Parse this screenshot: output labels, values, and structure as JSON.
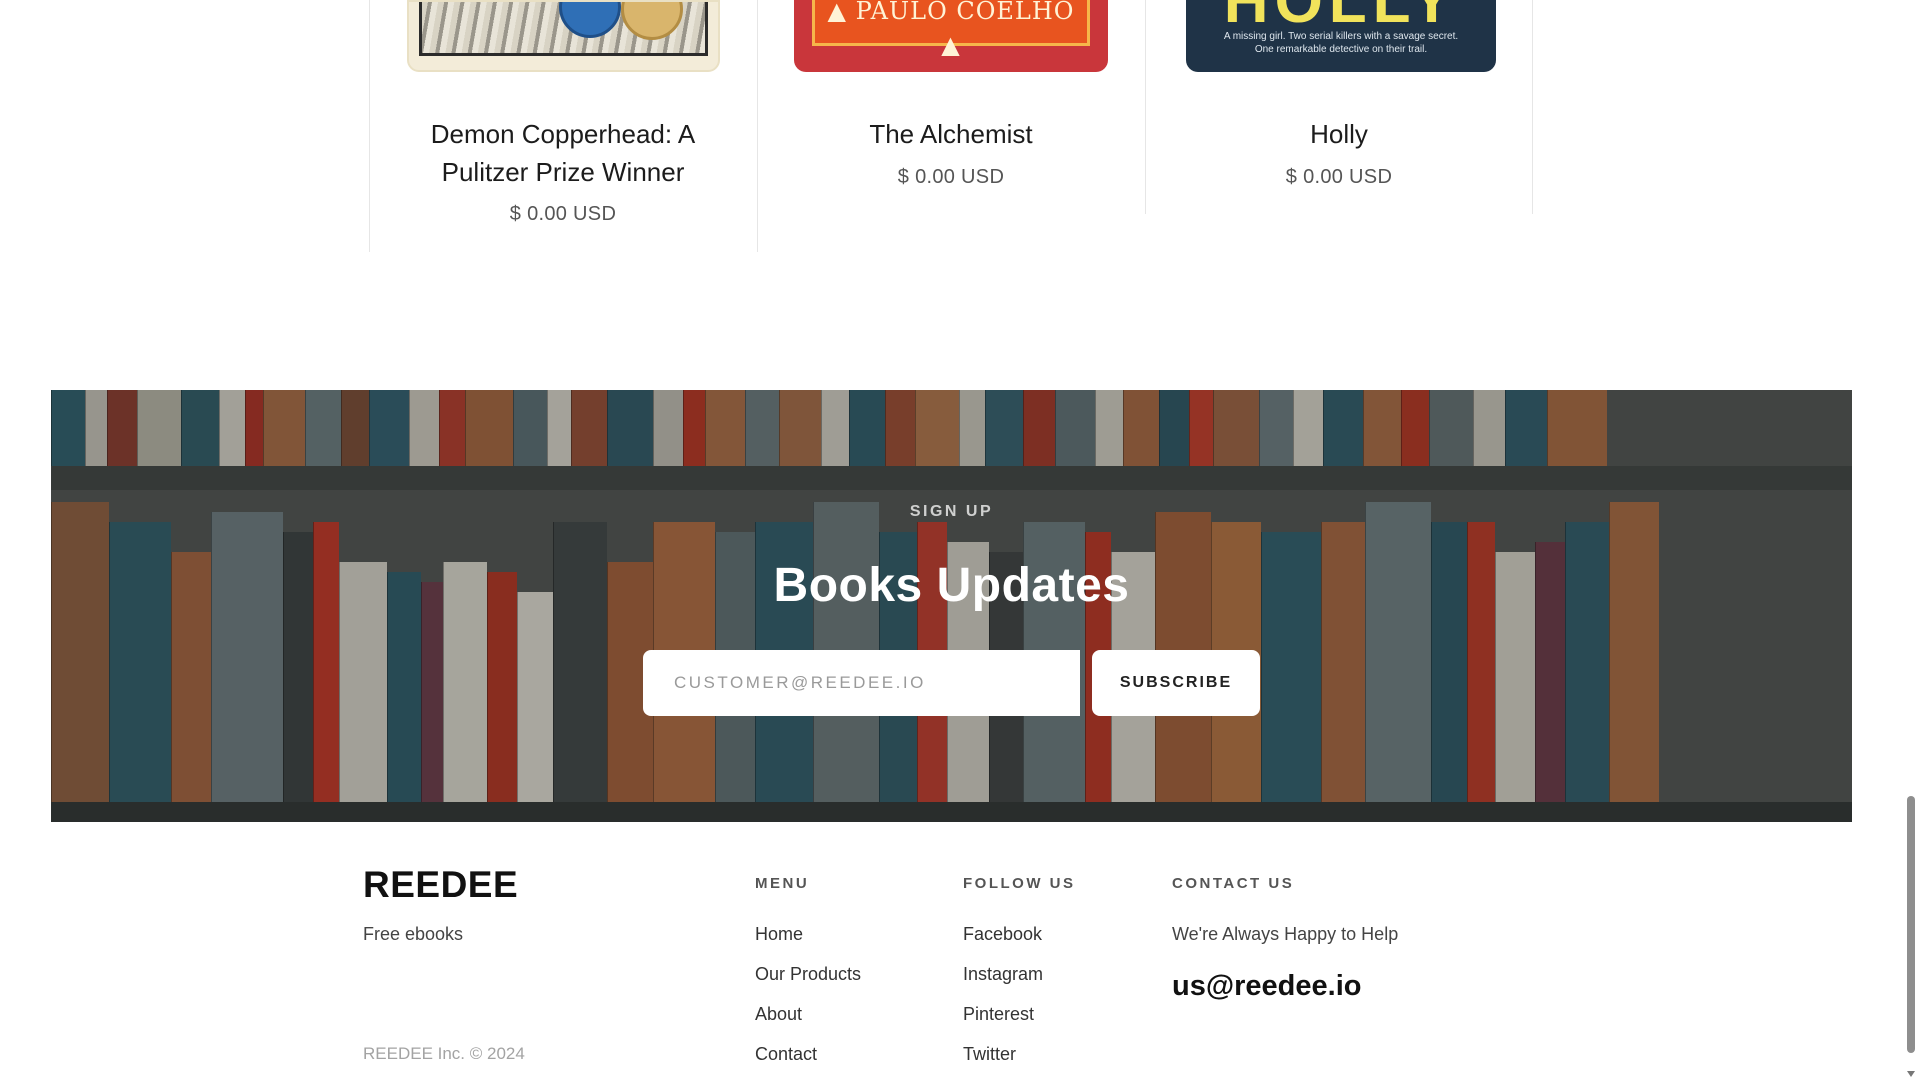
{
  "products": [
    {
      "title": "Demon Copperhead: A Pulitzer Prize Winner",
      "title_line1": "Demon Copperhead: A",
      "title_line2": "Pulitzer Prize Winner",
      "price": "$ 0.00 USD"
    },
    {
      "title": "The Alchemist",
      "cover_text": "PAULO COELHO",
      "price": "$ 0.00 USD"
    },
    {
      "title": "Holly",
      "cover_title": "HOLLY",
      "cover_tagline_1": "A missing girl. Two serial killers with a savage secret.",
      "cover_tagline_2": "One remarkable detective on their trail.",
      "price": "$ 0.00 USD"
    }
  ],
  "newsletter": {
    "eyebrow": "SIGN UP",
    "title": "Books Updates",
    "email_placeholder": "CUSTOMER@REEDEE.IO",
    "subscribe_label": "SUBSCRIBE"
  },
  "footer": {
    "brand": "REEDEE",
    "tagline": "Free ebooks",
    "copyright": "REEDEE Inc. © 2024",
    "menu": {
      "heading": "MENU",
      "links": [
        "Home",
        "Our Products",
        "About",
        "Contact"
      ]
    },
    "follow": {
      "heading": "FOLLOW US",
      "links": [
        "Facebook",
        "Instagram",
        "Pinterest",
        "Twitter"
      ]
    },
    "contact": {
      "heading": "CONTACT US",
      "line": "We're Always Happy to Help",
      "email": "us@reedee.io"
    }
  },
  "colors": {
    "text_dark": "#111111",
    "text_muted": "#555555",
    "banner_overlay": "#4f5250",
    "alchemist_cover": "#c9363b",
    "holly_cover": "#1f3347",
    "holly_title": "#f1e35b"
  }
}
